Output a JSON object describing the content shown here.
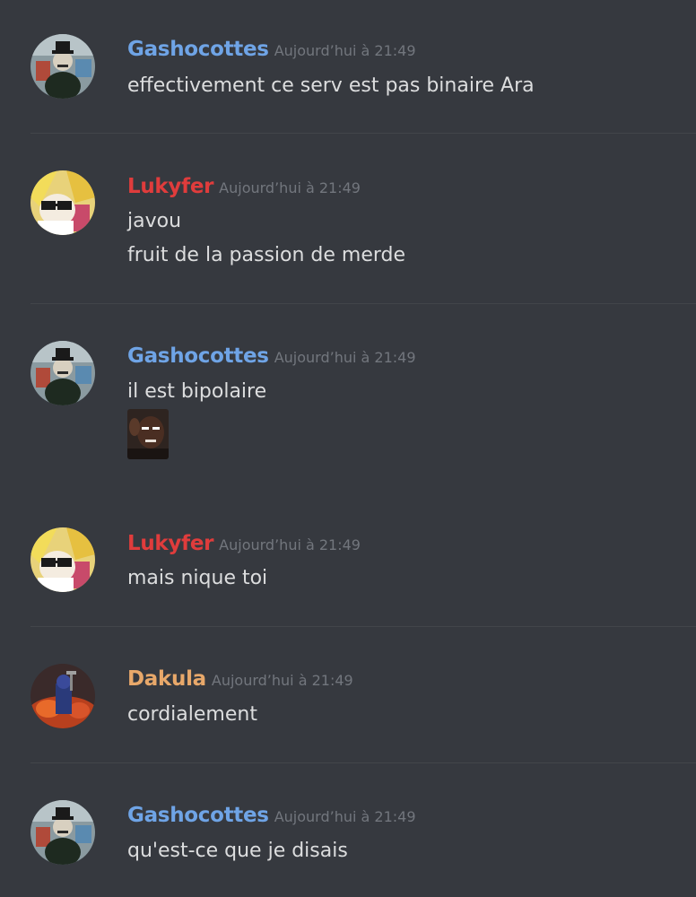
{
  "colors": {
    "background": "#36393f",
    "text": "#dcddde",
    "timestamp": "#72767d",
    "divider": "#42454a"
  },
  "messages": [
    {
      "author": "Gashocottes",
      "author_color": "#6fa4e6",
      "avatar": "gashocottes-avatar",
      "timestamp": "Aujourd’hui à 21:49",
      "lines": [
        "effectivement ce serv est pas binaire Ara"
      ]
    },
    {
      "author": "Lukyfer",
      "author_color": "#e03c3c",
      "avatar": "lukyfer-avatar",
      "timestamp": "Aujourd’hui à 21:49",
      "lines": [
        "javou",
        "fruit de la passion de merde"
      ]
    },
    {
      "author": "Gashocottes",
      "author_color": "#6fa4e6",
      "avatar": "gashocottes-avatar",
      "timestamp": "Aujourd’hui à 21:49",
      "lines": [
        "il est bipolaire"
      ],
      "emoji": "thinking-man-emoji"
    },
    {
      "author": "Lukyfer",
      "author_color": "#e03c3c",
      "avatar": "lukyfer-avatar",
      "timestamp": "Aujourd’hui à 21:49",
      "lines": [
        "mais nique toi"
      ]
    },
    {
      "author": "Dakula",
      "author_color": "#e8a86a",
      "avatar": "dakula-avatar",
      "timestamp": "Aujourd’hui à 21:49",
      "lines": [
        "cordialement"
      ]
    },
    {
      "author": "Gashocottes",
      "author_color": "#6fa4e6",
      "avatar": "gashocottes-avatar",
      "timestamp": "Aujourd’hui à 21:49",
      "lines": [
        "qu'est-ce que je disais"
      ]
    }
  ]
}
